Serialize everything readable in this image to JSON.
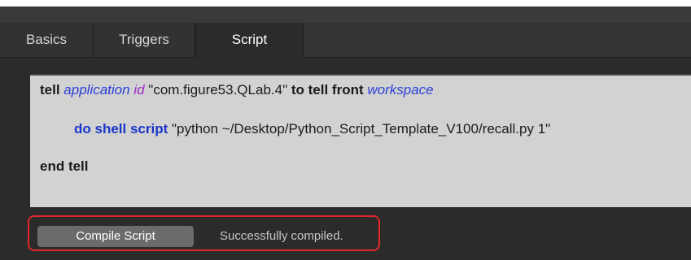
{
  "tabs": [
    {
      "label": "Basics",
      "active": false
    },
    {
      "label": "Triggers",
      "active": false
    },
    {
      "label": "Script",
      "active": true
    }
  ],
  "script": {
    "line1": {
      "tell": "tell",
      "application": "application",
      "id": "id",
      "bundle_id": "\"com.figure53.QLab.4\"",
      "to_tell_front": "to tell front",
      "workspace": "workspace"
    },
    "line2": {
      "do_shell_script": "do shell script",
      "command": "\"python ~/Desktop/Python_Script_Template_V100/recall.py 1\""
    },
    "line3": {
      "end_tell": "end tell"
    }
  },
  "footer": {
    "compile_button_label": "Compile Script",
    "status_text": "Successfully compiled."
  },
  "colors": {
    "highlight_border": "#e0252b",
    "keyword_blue": "#1a35c8",
    "class_blue": "#2a3fd6",
    "property_purple": "#9a2cc7"
  }
}
